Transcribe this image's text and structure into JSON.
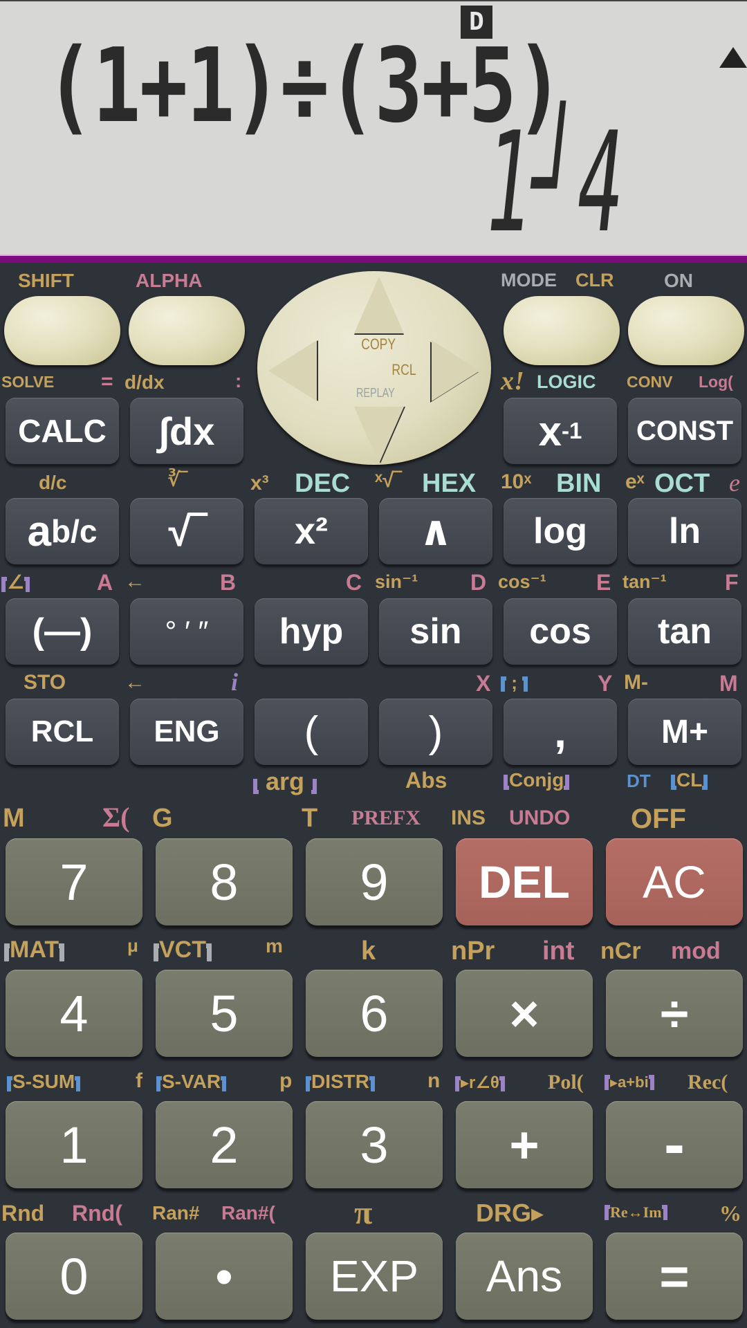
{
  "display": {
    "angle_indicator": "D",
    "scroll_indicator": "up-arrow",
    "expression": "(1+1)÷(3+5)",
    "result": "1┘4",
    "accent_bar_color": "#7e0a80"
  },
  "top_labels": {
    "shift": "SHIFT",
    "alpha": "ALPHA",
    "mode": "MODE",
    "clr": "CLR",
    "on": "ON"
  },
  "dpad": {
    "copy": "COPY",
    "rcl": "RCL",
    "replay": "REPLAY"
  },
  "row1_labels": {
    "solve": "SOLVE",
    "eq": "=",
    "ddx": "d/dx",
    "colon": ":",
    "xfact": "x!",
    "logic": "LOGIC",
    "conv": "CONV",
    "logbase": "Log("
  },
  "row1_keys": {
    "calc": "CALC",
    "integral": "∫dx",
    "xinv_base": "x",
    "xinv_sup": "-1",
    "const": "CONST"
  },
  "row2_labels": {
    "dc": "d/c",
    "cbrt": "∛‾",
    "x3": "x³",
    "dec": "DEC",
    "xroot": "ˣ√‾",
    "hex": "HEX",
    "tenx": "10ˣ",
    "bin": "BIN",
    "ex": "eˣ",
    "oct": "OCT",
    "e": "e"
  },
  "row2_keys": {
    "abc_a": "a",
    "abc_bc": "b/c",
    "sqrt": "√‾",
    "x2": "x²",
    "caret": "∧",
    "log": "log",
    "ln": "ln"
  },
  "row3_labels": {
    "angle": "∠",
    "A": "A",
    "left_arrow": "←",
    "B": "B",
    "C": "C",
    "asin": "sin⁻¹",
    "D": "D",
    "acos": "cos⁻¹",
    "E": "E",
    "atan": "tan⁻¹",
    "F": "F"
  },
  "row3_keys": {
    "neg": "(—)",
    "dms": "° ′ ″",
    "hyp": "hyp",
    "sin": "sin",
    "cos": "cos",
    "tan": "tan"
  },
  "row4_labels": {
    "sto": "STO",
    "left_arrow": "←",
    "i": "i",
    "X": "X",
    "semicolon": ";",
    "Y": "Y",
    "mminus": "M-",
    "M": "M"
  },
  "row4_keys": {
    "rcl": "RCL",
    "eng": "ENG",
    "lparen": "(",
    "rparen": ")",
    "comma": ",",
    "mplus": "M+"
  },
  "row4_sublabels": {
    "arg": "arg",
    "abs": "Abs",
    "conjg": "Conjg",
    "dt": "DT",
    "cl": "CL"
  },
  "num1_labels": {
    "M": "M",
    "sigma": "Σ(",
    "G": "G",
    "T": "T",
    "prefx": "PREFX",
    "ins": "INS",
    "undo": "UNDO",
    "off": "OFF"
  },
  "num1_keys": [
    "7",
    "8",
    "9",
    "DEL",
    "AC"
  ],
  "num2_labels": {
    "mat": "MAT",
    "mu": "μ",
    "vct": "VCT",
    "m": "m",
    "k": "k",
    "npr": "nPr",
    "int": "int",
    "ncr": "nCr",
    "mod": "mod"
  },
  "num2_keys": [
    "4",
    "5",
    "6",
    "×",
    "÷"
  ],
  "num3_labels": {
    "ssum": "S-SUM",
    "f": "f",
    "svar": "S-VAR",
    "p": "p",
    "distr": "DISTR",
    "n": "n",
    "polar": "▸r∠θ",
    "pol": "Pol(",
    "rect": "▸a+bi",
    "rec": "Rec("
  },
  "num3_keys": [
    "1",
    "2",
    "3",
    "+",
    "-"
  ],
  "num4_labels": {
    "rnd": "Rnd",
    "rndf": "Rnd(",
    "ran": "Ran#",
    "ranf": "Ran#(",
    "pi": "π",
    "drg": "DRG▸",
    "reim": "Re↔Im",
    "pct": "%"
  },
  "num4_keys": [
    "0",
    "•",
    "EXP",
    "Ans",
    "="
  ]
}
